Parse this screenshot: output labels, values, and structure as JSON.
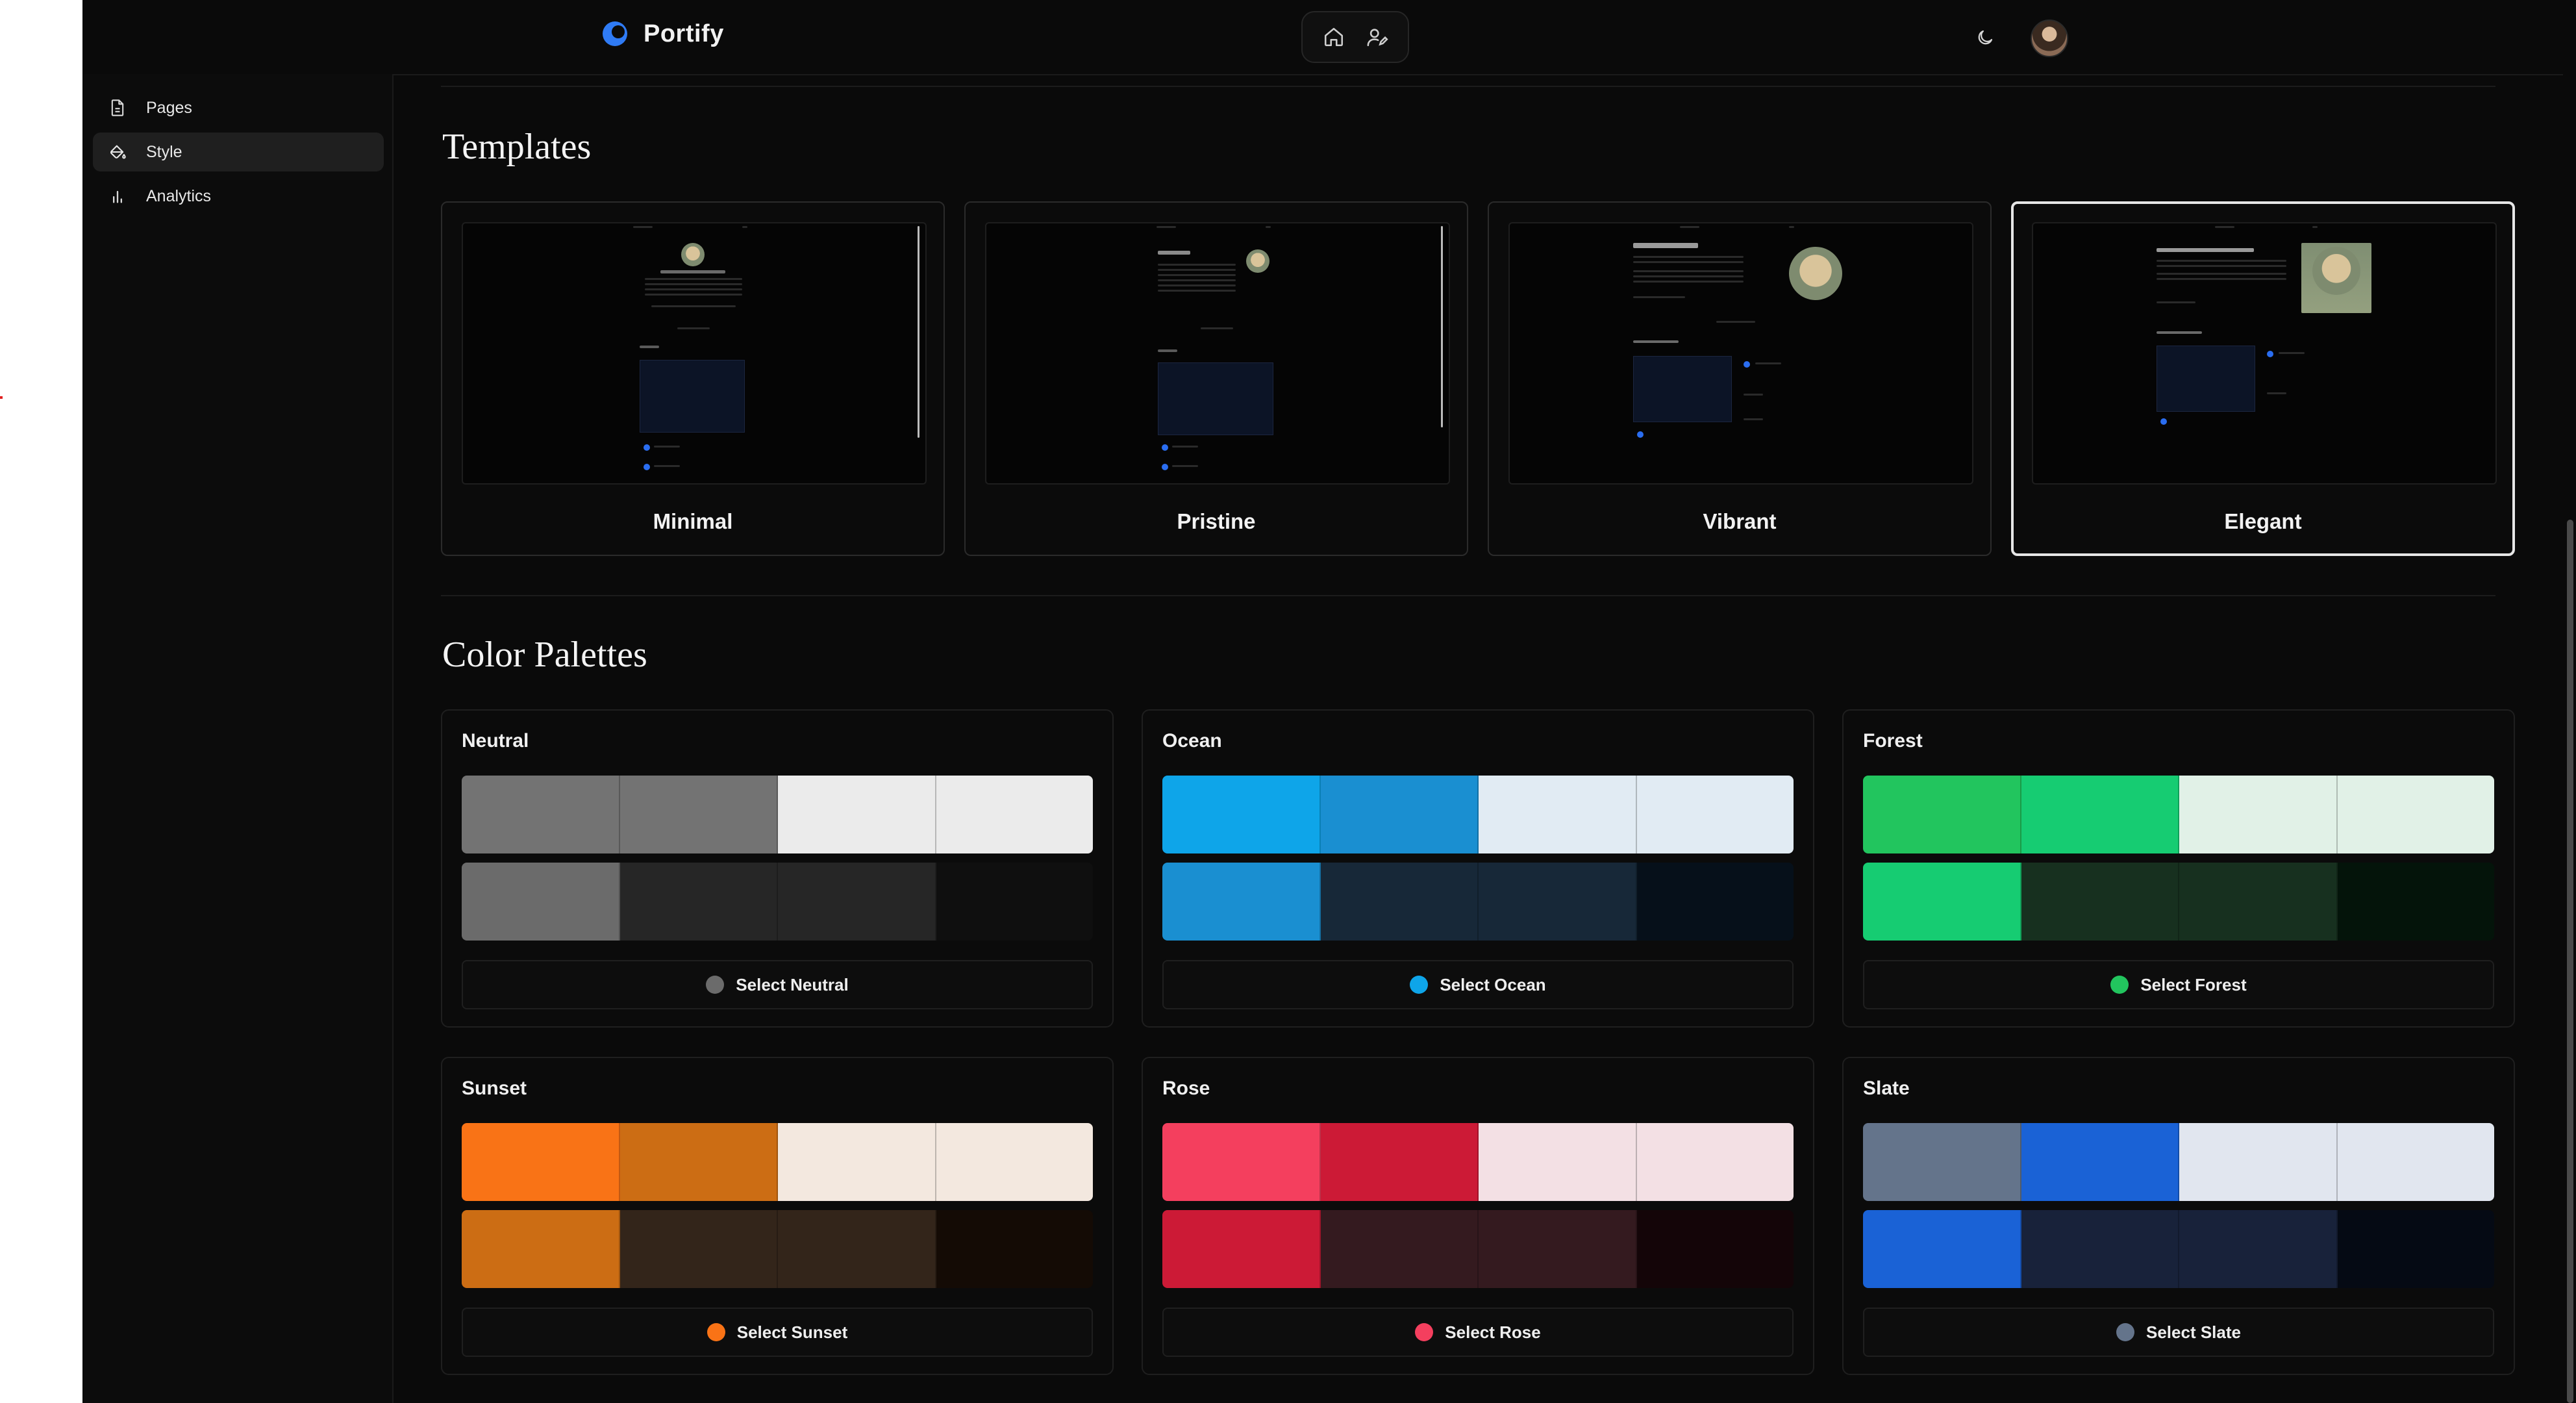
{
  "app": {
    "name": "Portify",
    "accent": "#2f7bf5"
  },
  "header": {
    "nav": [
      {
        "icon": "home-icon"
      },
      {
        "icon": "user-edit-icon"
      }
    ],
    "theme_icon": "moon-icon",
    "avatar_icon": "avatar"
  },
  "sidebar": {
    "items": [
      {
        "label": "Pages",
        "icon": "file-icon",
        "active": false
      },
      {
        "label": "Style",
        "icon": "paint-bucket-icon",
        "active": true
      },
      {
        "label": "Analytics",
        "icon": "bar-chart-icon",
        "active": false
      }
    ]
  },
  "templates": {
    "title": "Templates",
    "items": [
      {
        "name": "Minimal",
        "selected": false
      },
      {
        "name": "Pristine",
        "selected": false
      },
      {
        "name": "Vibrant",
        "selected": false
      },
      {
        "name": "Elegant",
        "selected": true
      }
    ]
  },
  "palettes": {
    "title": "Color Palettes",
    "items": [
      {
        "name": "Neutral",
        "button": "Select Neutral",
        "dot": "#6b6b6b",
        "light": [
          "#737373",
          "#737373",
          "#ebebeb",
          "#ebebeb"
        ],
        "dark": [
          "#6b6b6b",
          "#262626",
          "#262626",
          "#0f0f0f"
        ]
      },
      {
        "name": "Ocean",
        "button": "Select Ocean",
        "dot": "#0ea5e9",
        "light": [
          "#0ea5e9",
          "#1a8fd1",
          "#e1ebf3",
          "#e1ebf3"
        ],
        "dark": [
          "#1a8fd1",
          "#172838",
          "#172838",
          "#06101a"
        ]
      },
      {
        "name": "Forest",
        "button": "Select Forest",
        "dot": "#22c55e",
        "light": [
          "#22c55e",
          "#16cc72",
          "#e1f1e7",
          "#e1f1e7"
        ],
        "dark": [
          "#16cc72",
          "#17301f",
          "#17301f",
          "#04140a"
        ]
      },
      {
        "name": "Sunset",
        "button": "Select Sunset",
        "dot": "#f97316",
        "light": [
          "#f97316",
          "#cc6d14",
          "#f3e8df",
          "#f3e8df"
        ],
        "dark": [
          "#cc6d14",
          "#33251a",
          "#33251a",
          "#140b05"
        ]
      },
      {
        "name": "Rose",
        "button": "Select Rose",
        "dot": "#f43f5e",
        "light": [
          "#f43f5e",
          "#cc1a36",
          "#f3e0e4",
          "#f3e0e4"
        ],
        "dark": [
          "#cc1a36",
          "#341a1f",
          "#341a1f",
          "#140508"
        ]
      },
      {
        "name": "Slate",
        "button": "Select Slate",
        "dot": "#64748b",
        "light": [
          "#64748b",
          "#1a62d6",
          "#e1e6ef",
          "#e1e6ef"
        ],
        "dark": [
          "#1a62d6",
          "#18223a",
          "#18223a",
          "#050a14"
        ]
      }
    ]
  }
}
